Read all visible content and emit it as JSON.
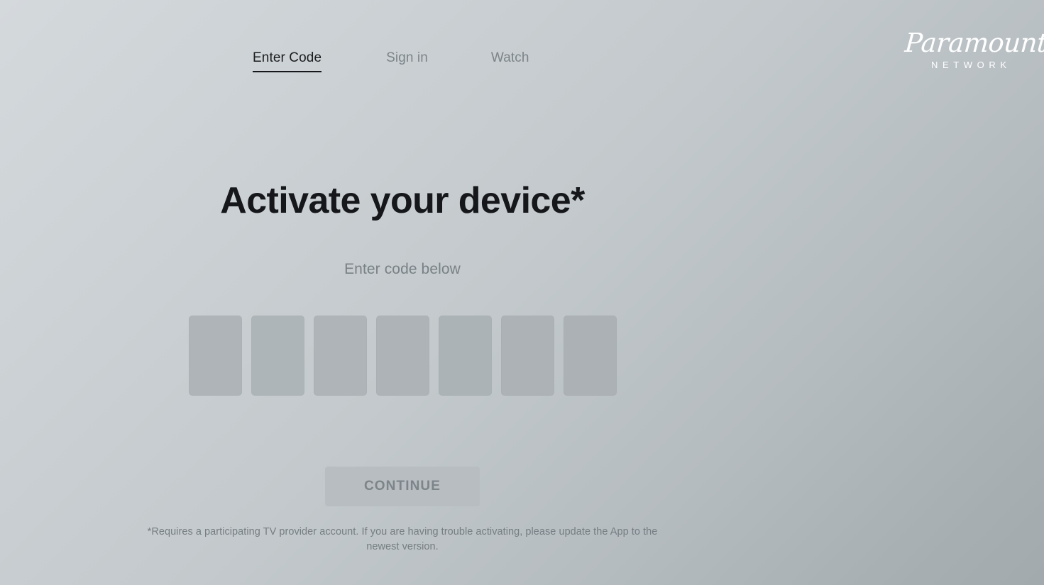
{
  "page": {
    "background_top_color": "#d4d9dc",
    "background_bottom_color": "#a2aaae"
  },
  "header": {
    "nav": [
      {
        "label": "Enter Code",
        "active": true
      },
      {
        "label": "Sign in",
        "active": false
      },
      {
        "label": "Watch",
        "active": false
      }
    ],
    "logo": {
      "wordmark": "Paramount",
      "subtitle": "NETWORK",
      "color": "#ffffff"
    }
  },
  "main": {
    "title": "Activate your device*",
    "subtitle": "Enter code below",
    "code_input": {
      "length": 7,
      "values": [
        "",
        "",
        "",
        "",
        "",
        "",
        ""
      ],
      "placeholder": "",
      "box_color": "#aeb4b8"
    },
    "continue_button": {
      "label": "CONTINUE",
      "enabled": false,
      "background": "#b7bdc0",
      "text_color": "#7d858a"
    },
    "footnote": "*Requires a participating TV provider account. If you are having trouble activating, please update the App to the newest version."
  }
}
